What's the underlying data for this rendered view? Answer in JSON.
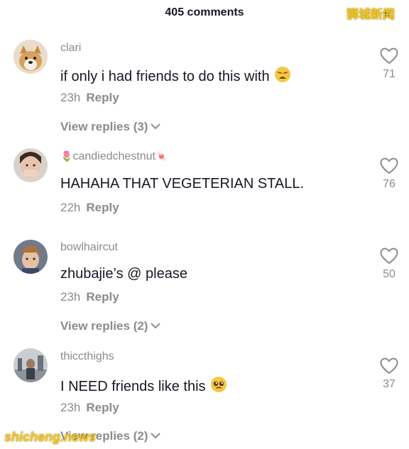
{
  "header": {
    "title": "405 comments",
    "close_icon": "close-icon"
  },
  "watermarks": {
    "top": "狮城新闻",
    "bottom": "shicheng.news"
  },
  "comments": [
    {
      "username": "clari",
      "text": "if only i had friends to do this with",
      "emoji": "weary-face-emoji",
      "time": "23h",
      "reply_label": "Reply",
      "likes": "71",
      "view_replies": "View replies (3)"
    },
    {
      "username": "candiedchestnut",
      "username_prefix_icon": "tulip-icon",
      "username_suffix_icon": "candy-icon",
      "text": "HAHAHA THAT VEGETERIAN STALL.",
      "time": "22h",
      "reply_label": "Reply",
      "likes": "76"
    },
    {
      "username": "bowlhaircut",
      "text": "zhubajie’s @ please",
      "time": "23h",
      "reply_label": "Reply",
      "likes": "50",
      "view_replies": "View replies (2)"
    },
    {
      "username": "thiccthighs",
      "text": "I NEED friends like this",
      "emoji": "pleading-face-emoji",
      "time": "23h",
      "reply_label": "Reply",
      "likes": "37",
      "view_replies": "View replies (2)"
    }
  ],
  "colors": {
    "primary_text": "#161823",
    "secondary_text": "#8a8b91",
    "watermark": "#f3c623"
  }
}
